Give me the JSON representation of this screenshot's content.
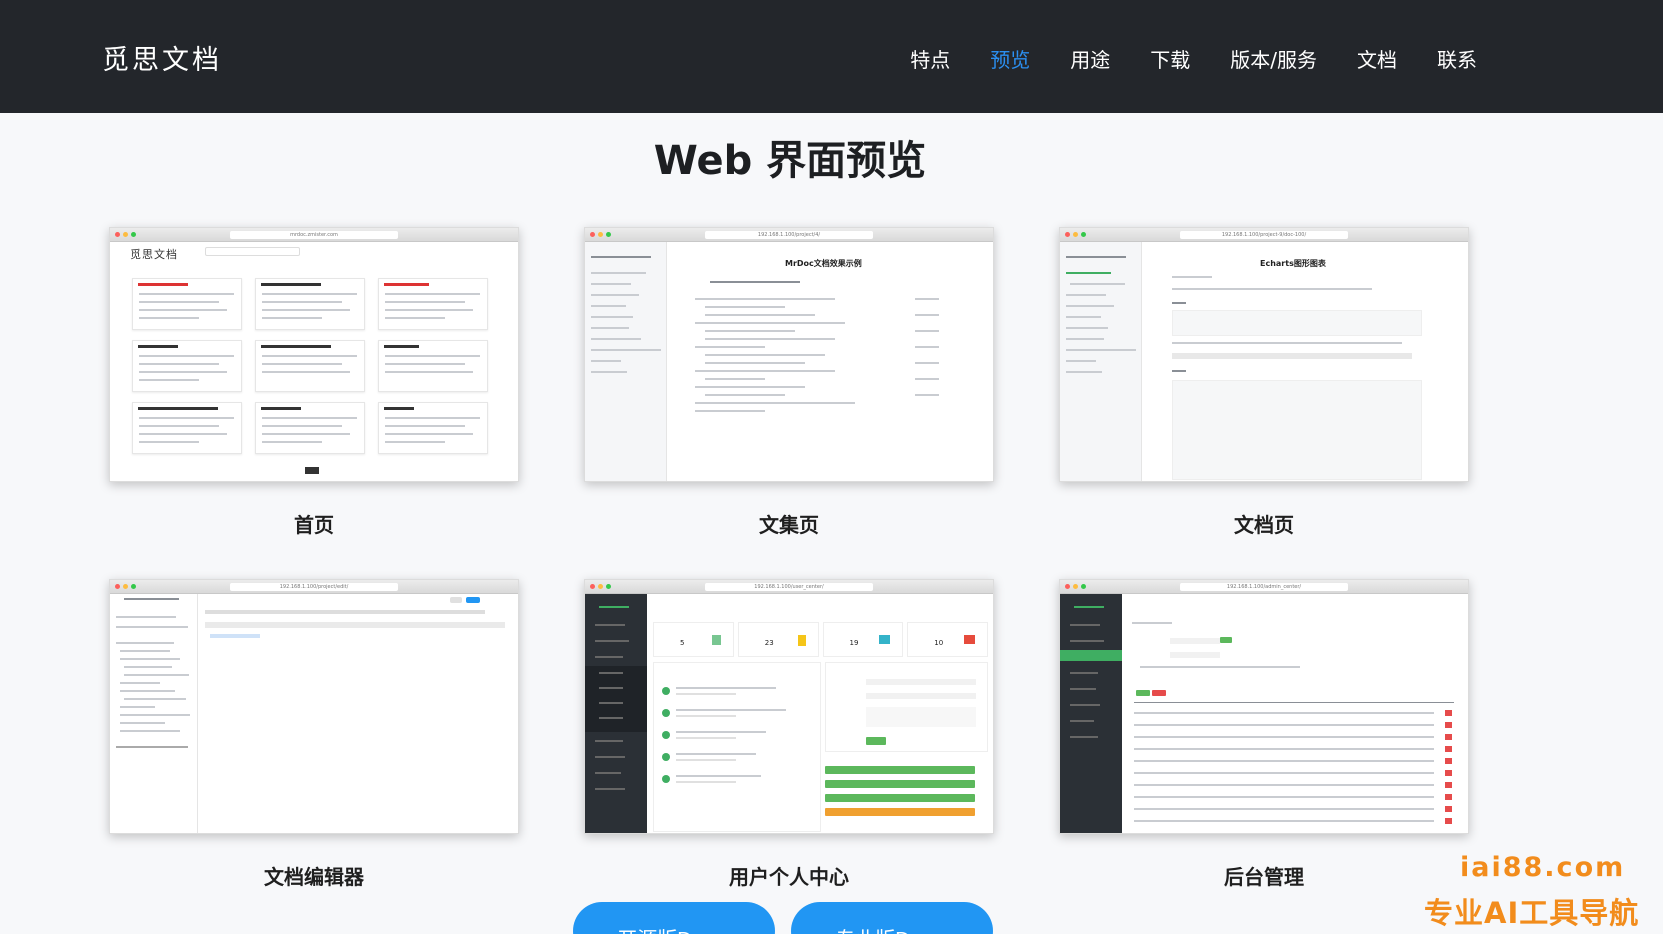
{
  "header": {
    "logo": "觅思文档",
    "nav": [
      "特点",
      "预览",
      "用途",
      "下载",
      "版本/服务",
      "文档",
      "联系"
    ],
    "active_index": 1
  },
  "section": {
    "title": "Web 界面预览"
  },
  "cards": [
    {
      "caption": "首页",
      "url": "mrdoc.zmister.com"
    },
    {
      "caption": "文集页",
      "url": "192.168.1.100/project/4/",
      "doc_title": "MrDoc文档效果示例"
    },
    {
      "caption": "文档页",
      "url": "192.168.1.100/project-9/doc-100/",
      "doc_title": "Echarts图形图表"
    },
    {
      "caption": "文档编辑器",
      "url": "192.168.1.100/project/edit/"
    },
    {
      "caption": "用户个人中心",
      "url": "192.168.1.100/user_center/",
      "stats": [
        "5",
        "23",
        "19",
        "10"
      ]
    },
    {
      "caption": "后台管理",
      "url": "192.168.1.100/admin_center/"
    }
  ],
  "buttons": {
    "open_source_demo": "开源版Demo",
    "pro_demo": "专业版Demo"
  },
  "watermark": {
    "domain": "iai88.com",
    "slogan": "专业AI工具导航"
  },
  "colors": {
    "header_bg": "#23262b",
    "active_nav": "#2b8ff0",
    "button_blue": "#2196f3",
    "watermark_orange": "#f28c1c"
  }
}
